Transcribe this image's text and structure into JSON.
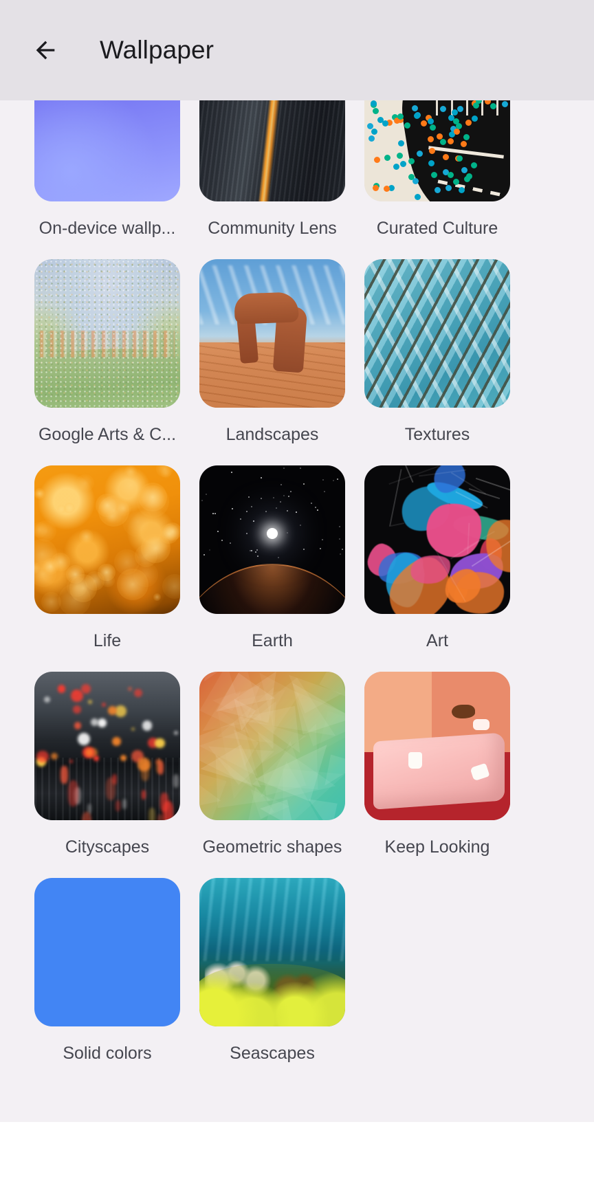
{
  "app": {
    "screen_title": "Wallpaper",
    "background_color": "#f3f0f4",
    "appbar_color": "#e4e1e6",
    "text_color": "#45464f",
    "title_color": "#1b1b1f"
  },
  "appbar": {
    "back_label": "Navigate up",
    "title": "Wallpaper"
  },
  "grid": {
    "columns": 3,
    "items": [
      {
        "label": "On-device wallp...",
        "full_label": "On-device wallpapers",
        "art": "art-ondevice"
      },
      {
        "label": "Community Lens",
        "full_label": "Community Lens",
        "art": "art-community"
      },
      {
        "label": "Curated Culture",
        "full_label": "Curated Culture",
        "art": "art-culture"
      },
      {
        "label": "Google Arts & C...",
        "full_label": "Google Arts & Culture",
        "art": "art-arts"
      },
      {
        "label": "Landscapes",
        "full_label": "Landscapes",
        "art": "art-land"
      },
      {
        "label": "Textures",
        "full_label": "Textures",
        "art": "art-tex"
      },
      {
        "label": "Life",
        "full_label": "Life",
        "art": "art-life"
      },
      {
        "label": "Earth",
        "full_label": "Earth",
        "art": "art-earth"
      },
      {
        "label": "Art",
        "full_label": "Art",
        "art": "art-art"
      },
      {
        "label": "Cityscapes",
        "full_label": "Cityscapes",
        "art": "art-city"
      },
      {
        "label": "Geometric shapes",
        "full_label": "Geometric shapes",
        "art": "art-geo"
      },
      {
        "label": "Keep Looking",
        "full_label": "Keep Looking",
        "art": "art-keep"
      },
      {
        "label": "Solid colors",
        "full_label": "Solid colors",
        "art": "art-solid",
        "color": "#4285f4"
      },
      {
        "label": "Seascapes",
        "full_label": "Seascapes",
        "art": "art-sea"
      }
    ]
  }
}
